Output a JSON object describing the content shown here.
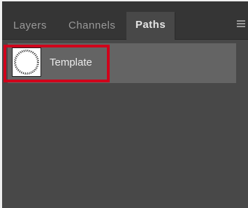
{
  "tabs": [
    {
      "label": "Layers",
      "active": false
    },
    {
      "label": "Channels",
      "active": false
    },
    {
      "label": "Paths",
      "active": true
    }
  ],
  "panel_menu_icon": "hamburger-menu-icon",
  "paths": [
    {
      "name": "Template",
      "selected": true,
      "thumbnail_icon": "dotted-circle-icon"
    }
  ],
  "colors": {
    "panel_bg": "#484848",
    "tabbar_bg": "#353535",
    "selected_row_bg": "#646464",
    "highlight": "#d0021b",
    "active_tab_text": "#e6e6e6",
    "inactive_tab_text": "#9a9a9a"
  }
}
